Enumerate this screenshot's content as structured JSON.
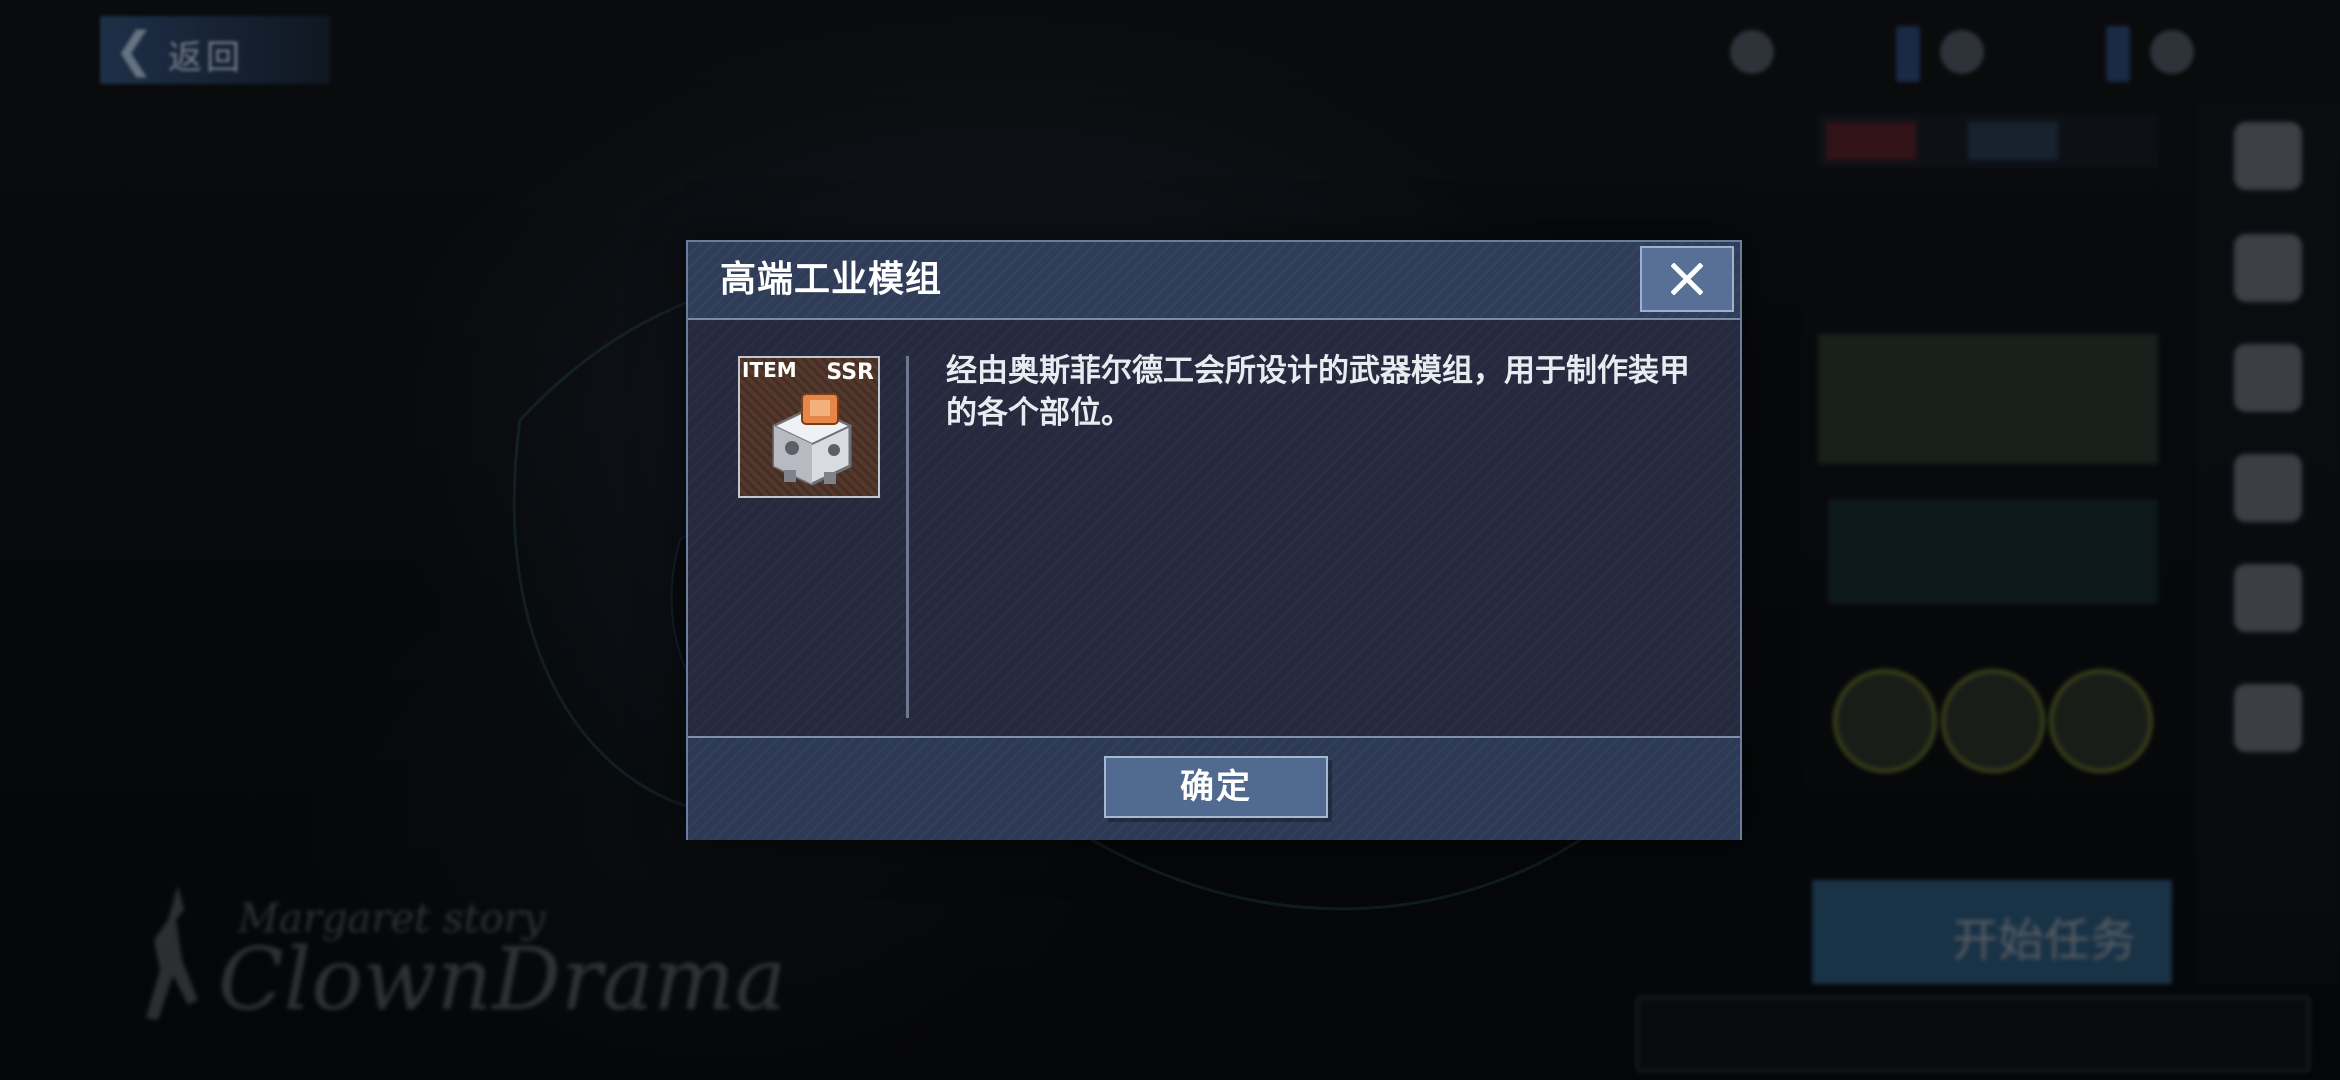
{
  "dialog": {
    "title": "高端工业模组",
    "item": {
      "type_label": "ITEM",
      "rarity": "SSR"
    },
    "description": "经由奥斯菲尔德工会所设计的武器模组，用于制作装甲的各个部位。",
    "confirm_label": "确定"
  },
  "background": {
    "back_label": "返回",
    "watermark_subtitle": "Margaret story",
    "watermark_title": "ClownDrama",
    "start_mission_label": "开始任务"
  },
  "colors": {
    "dialog_bg": "#252a3e",
    "dialog_header": "#2f3d59",
    "button_bg": "#516a8f",
    "rarity_bg": "#54382c"
  }
}
